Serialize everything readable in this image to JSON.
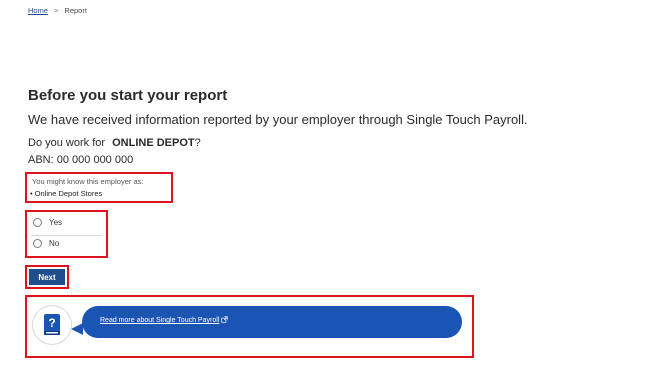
{
  "breadcrumb": {
    "home_label": "Home",
    "separator": ">",
    "current_label": "Report"
  },
  "heading": {
    "title": "Before you start your report",
    "intro": "We have received information reported by your employer through Single Touch Payroll."
  },
  "employer": {
    "question_prefix": "Do you work for",
    "name": "ONLINE DEPOT",
    "question_suffix": "?",
    "abn_label": "ABN:",
    "abn_value": "00 000 000 000",
    "aka_label": "You might know this employer as:",
    "aka_items": [
      "• Online Depot Stores"
    ]
  },
  "options": {
    "yes_label": "Yes",
    "no_label": "No",
    "selected": null
  },
  "actions": {
    "next_label": "Next"
  },
  "help": {
    "icon": "help-book-icon",
    "link_label": "Read more about Single Touch Payroll",
    "link_icon": "external-link-icon"
  },
  "colors": {
    "highlight": "#e0121d",
    "primary": "#1f4e8c",
    "help_pill": "#1a55b3",
    "link": "#1f4e8c"
  }
}
